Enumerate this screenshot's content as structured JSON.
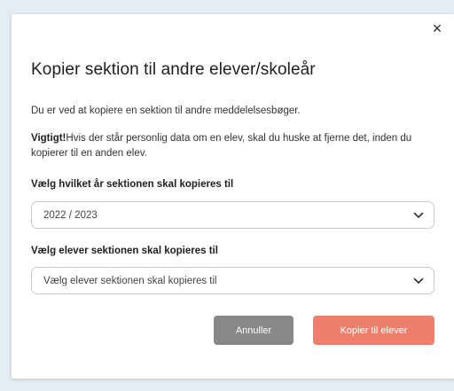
{
  "dialog": {
    "close_glyph": "×",
    "title": "Kopier sektion til andre elever/skoleår",
    "intro": "Du er ved at kopiere en sektion til andre meddelelsesbøger.",
    "warning_strong": "Vigtigt!",
    "warning_text": "Hvis der står personlig data om en elev, skal du huske at fjerne det, inden du kopierer til en anden elev."
  },
  "year_field": {
    "label": "Vælg hvilket år sektionen skal kopieres til",
    "value": "2022 / 2023",
    "icon": "chevron-down-icon"
  },
  "students_field": {
    "label": "Vælg elever sektionen skal kopieres til",
    "placeholder": "Vælg elever sektionen skal kopieres til",
    "icon": "chevron-down-icon"
  },
  "actions": {
    "cancel_label": "Annuller",
    "copy_label": "Kopier til elever"
  },
  "colors": {
    "backdrop": "#e3edf2",
    "cancel_bg": "#888888",
    "primary_bg": "#ef7f6c"
  }
}
